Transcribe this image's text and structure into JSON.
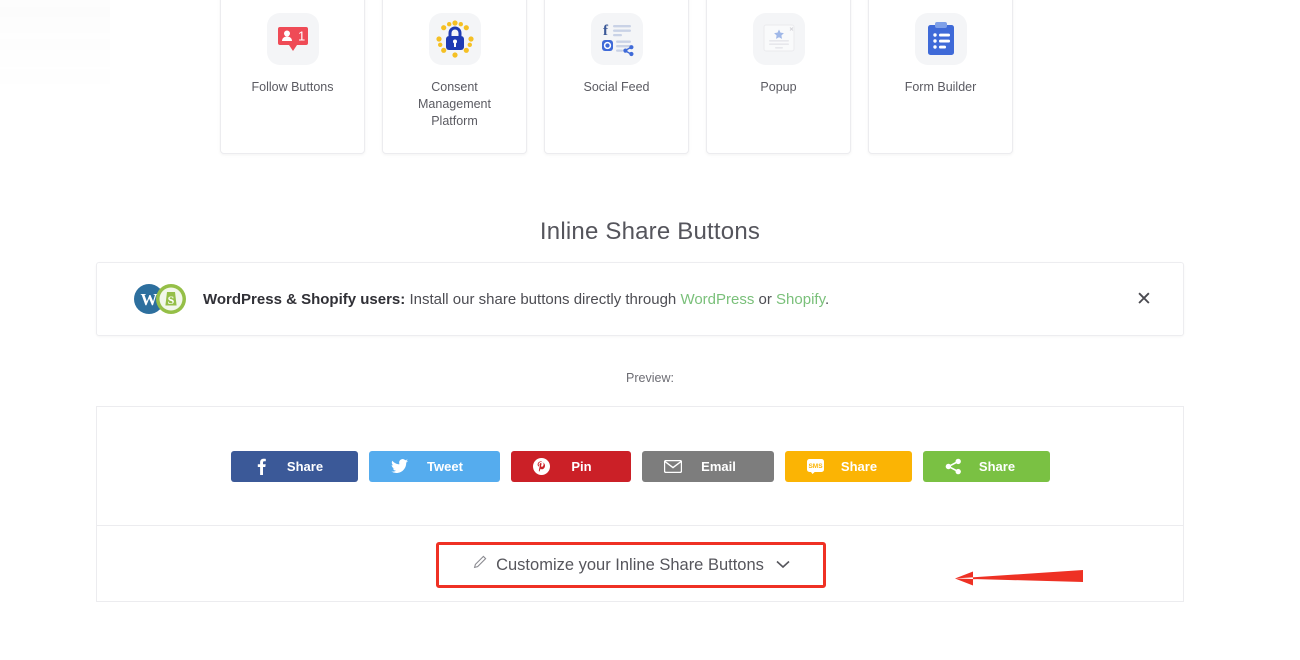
{
  "cards": [
    {
      "label": "Follow Buttons",
      "icon": "follow-buttons-icon"
    },
    {
      "label": "Consent Management Platform",
      "icon": "consent-management-icon"
    },
    {
      "label": "Social Feed",
      "icon": "social-feed-icon"
    },
    {
      "label": "Popup",
      "icon": "popup-icon"
    },
    {
      "label": "Form Builder",
      "icon": "form-builder-icon"
    }
  ],
  "section": {
    "title": "Inline Share Buttons"
  },
  "notice": {
    "bold_text": "WordPress & Shopify users:",
    "text_before": " Install our share buttons directly through ",
    "link_wordpress": "WordPress",
    "text_middle": " or ",
    "link_shopify": "Shopify",
    "text_after": ".",
    "close_glyph": "✕",
    "logo_wordpress": "wordpress-logo-icon",
    "logo_shopify": "shopify-logo-icon",
    "link_color": "#7ac07a"
  },
  "preview": {
    "label": "Preview:"
  },
  "share_buttons": [
    {
      "label": "Share",
      "network": "facebook",
      "icon": "facebook-icon",
      "color": "#3b5998"
    },
    {
      "label": "Tweet",
      "network": "twitter",
      "icon": "twitter-icon",
      "color": "#55acee"
    },
    {
      "label": "Pin",
      "network": "pinterest",
      "icon": "pinterest-icon",
      "color": "#cb2027"
    },
    {
      "label": "Email",
      "network": "email",
      "icon": "envelope-icon",
      "color": "#7d7d7d"
    },
    {
      "label": "Share",
      "network": "sms",
      "icon": "sms-icon",
      "color": "#fbb404"
    },
    {
      "label": "Share",
      "network": "sharethis",
      "icon": "share-network-icon",
      "color": "#7ac143"
    }
  ],
  "customize": {
    "label": "Customize your Inline Share Buttons",
    "pencil_icon": "pencil-icon",
    "chevron_icon": "chevron-down-icon",
    "highlight_color": "#ef3124"
  },
  "annotation": {
    "arrow_icon": "red-arrow-left-icon",
    "color": "#ee3124"
  }
}
